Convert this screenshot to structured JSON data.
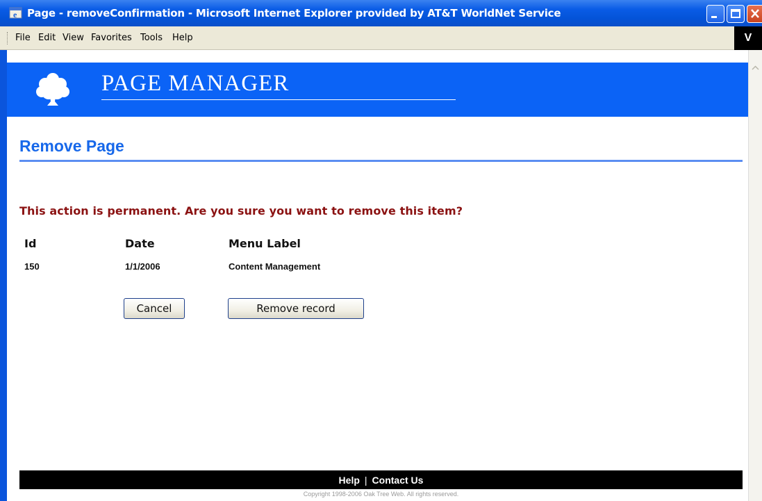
{
  "window": {
    "title": "Page - removeConfirmation - Microsoft Internet Explorer provided by AT&T WorldNet Service"
  },
  "menu": {
    "items": [
      "File",
      "Edit",
      "View",
      "Favorites",
      "Tools",
      "Help"
    ],
    "brand_letter": "V"
  },
  "banner": {
    "title": "PAGE MANAGER"
  },
  "page": {
    "title": "Remove Page",
    "warning": "This action is permanent. Are you sure you want to remove this item?",
    "columns": [
      "Id",
      "Date",
      "Menu Label"
    ],
    "record": {
      "id": "150",
      "date": "1/1/2006",
      "menu_label": "Content Management"
    },
    "cancel_label": "Cancel",
    "remove_label": "Remove record"
  },
  "footer": {
    "links": [
      "Help",
      "Contact Us"
    ],
    "separator": "|",
    "copyright": "Copyright 1998-2006 Oak Tree Web. All rights reserved."
  },
  "colors": {
    "banner_blue": "#0b63f6",
    "heading_blue": "#1768ea",
    "warning_red": "#8b1212"
  }
}
